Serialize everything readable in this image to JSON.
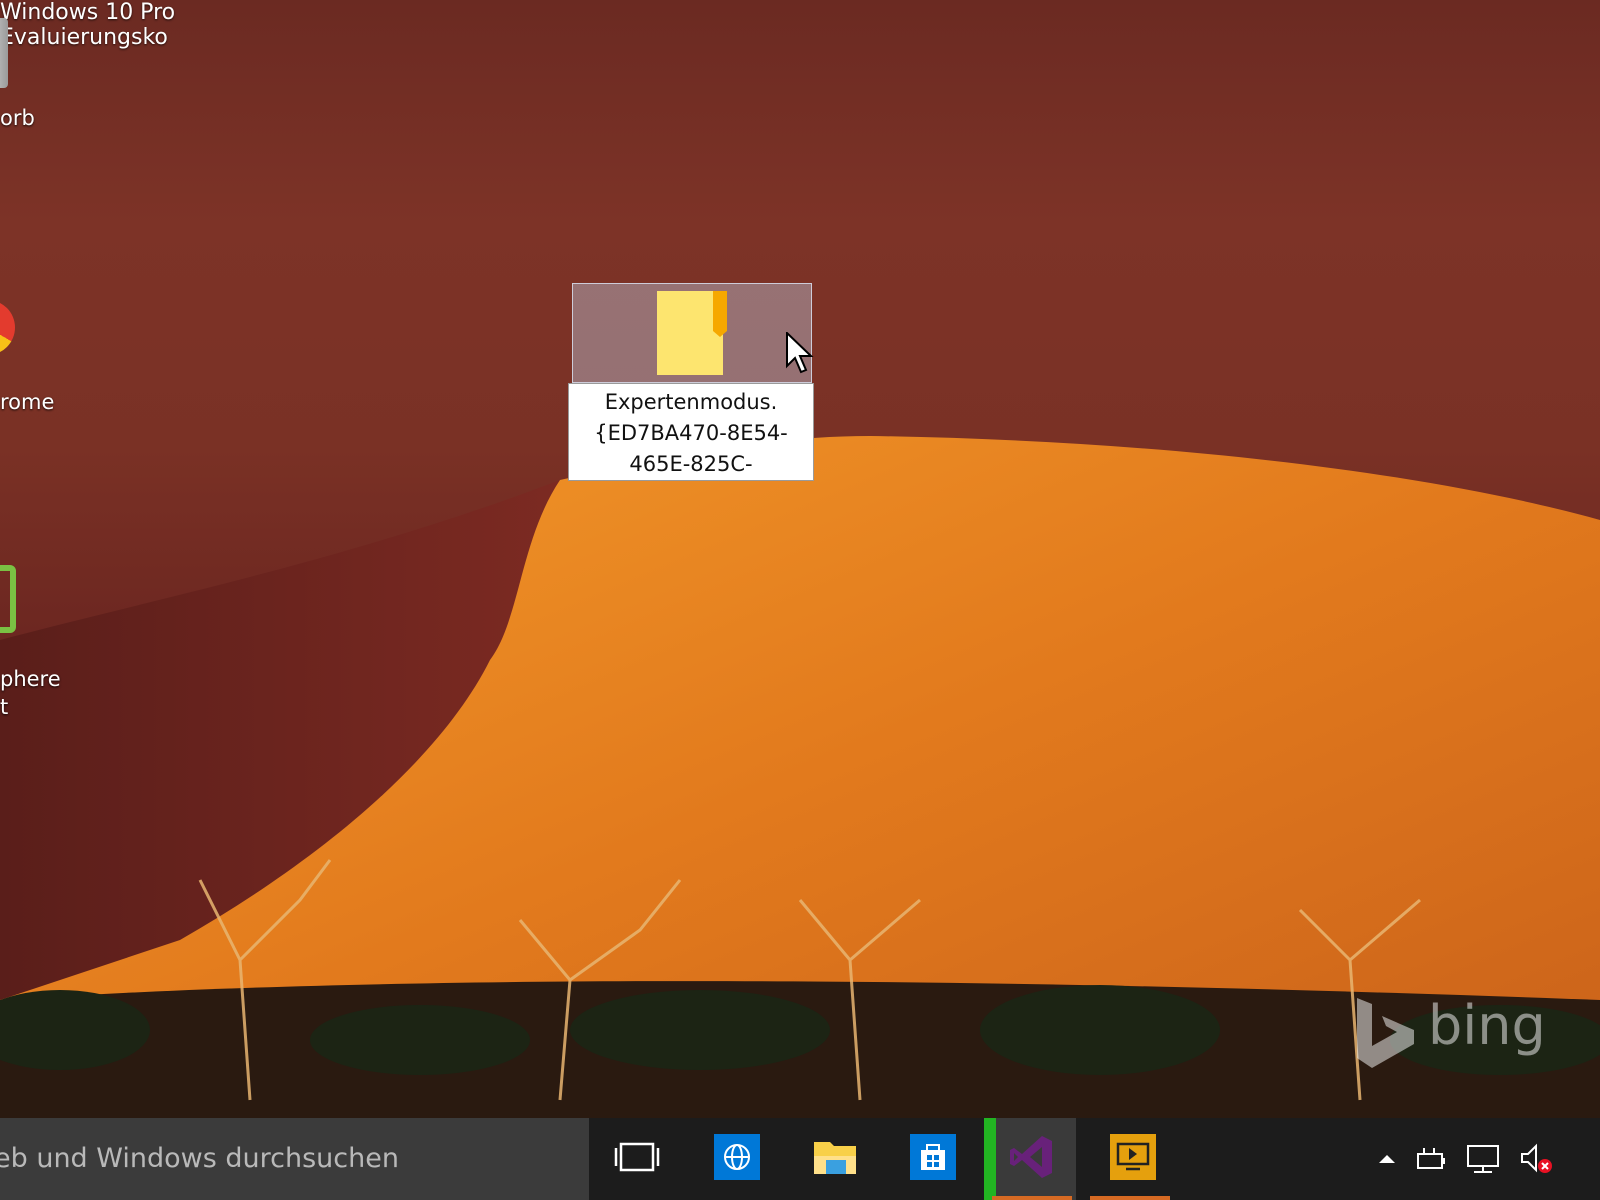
{
  "desktop": {
    "icons": [
      {
        "id": "recycle",
        "label": "orb"
      },
      {
        "id": "chrome",
        "label": "rome"
      },
      {
        "id": "vsphere",
        "label": "phere",
        "label2": "t"
      }
    ],
    "selected_item": {
      "label_line1": "Expertenmodus.",
      "label_line2": "{ED7BA470-8E54-",
      "label_line3": "465E-825C-"
    },
    "bing_word": "bing",
    "watermark_line1": "Windows 10 Pro",
    "watermark_line2": "Evaluierungsko"
  },
  "taskbar": {
    "search_placeholder": "eb und Windows durchsuchen",
    "buttons": [
      {
        "name": "task-view",
        "icon": "task-view-icon"
      },
      {
        "name": "internet-explorer",
        "icon": "globe-icon"
      },
      {
        "name": "file-explorer",
        "icon": "folder-icon"
      },
      {
        "name": "store",
        "icon": "store-bag-icon"
      },
      {
        "name": "visual-studio",
        "icon": "visual-studio-icon"
      },
      {
        "name": "plex",
        "icon": "plex-icon"
      }
    ],
    "tray_icons": [
      "chevron-up-icon",
      "power-plug-icon",
      "network-icon",
      "speaker-muted-icon"
    ]
  },
  "colors": {
    "taskbar_bg": "#1c1c1c",
    "search_bg": "#3b3b3b",
    "accent_blue": "#0078d7",
    "running_green": "#22b422",
    "active_underline": "#d66a23"
  }
}
